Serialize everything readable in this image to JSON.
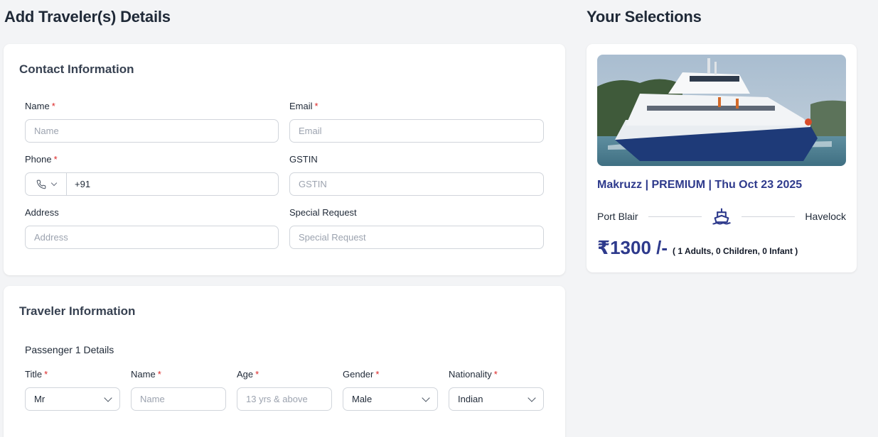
{
  "page": {
    "title": "Add Traveler(s) Details",
    "side_title": "Your Selections"
  },
  "contact": {
    "title": "Contact Information",
    "required_mark": "*",
    "name": {
      "label": "Name",
      "placeholder": "Name"
    },
    "email": {
      "label": "Email",
      "placeholder": "Email"
    },
    "phone": {
      "label": "Phone",
      "value": "+91"
    },
    "gstin": {
      "label": "GSTIN",
      "placeholder": "GSTIN"
    },
    "address": {
      "label": "Address",
      "placeholder": "Address"
    },
    "special_request": {
      "label": "Special Request",
      "placeholder": "Special Request"
    }
  },
  "traveler": {
    "title": "Traveler Information",
    "passenger_heading": "Passenger 1 Details",
    "title_field": {
      "label": "Title",
      "value": "Mr"
    },
    "name_field": {
      "label": "Name",
      "placeholder": "Name"
    },
    "age_field": {
      "label": "Age",
      "placeholder": "13 yrs & above"
    },
    "gender_field": {
      "label": "Gender",
      "value": "Male"
    },
    "nationality_field": {
      "label": "Nationality",
      "value": "Indian"
    }
  },
  "selection": {
    "trip_title": "Makruzz | PREMIUM | Thu Oct 23 2025",
    "from": "Port Blair",
    "to": "Havelock",
    "price": "₹1300 /-",
    "pax": "( 1 Adults, 0 Children, 0 Infant )",
    "image_icon": "ferry-photo",
    "route_icon": "ship-icon"
  },
  "colors": {
    "accent": "#2e3a8c",
    "required": "#dc2626",
    "background": "#f3f4f6"
  }
}
